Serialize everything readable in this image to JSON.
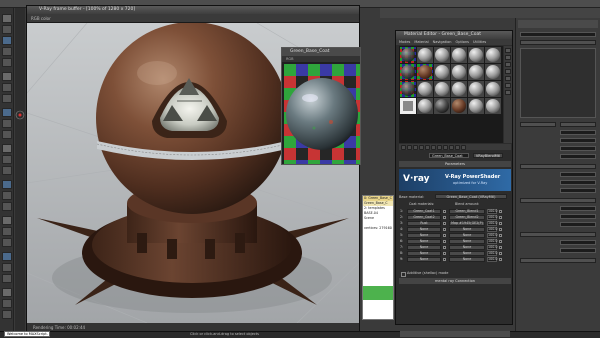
{
  "vfb": {
    "title": "V-Ray frame buffer - [100% of 1280 x 720]",
    "toolbar_channel": "RGB color",
    "status": "Rendering Time: 00:02:44"
  },
  "swatch_window": {
    "title": "Green_Base_Coat",
    "bar": "RGB"
  },
  "material_editor": {
    "title": "Material Editor - Green_Base_Coat",
    "menu": [
      "Modes",
      "Material",
      "Navigation",
      "Options",
      "Utilities"
    ],
    "material_name": "Green_Base_Coat",
    "material_type": "VRayBlendMtl",
    "params_header": "Parameters",
    "vray_logo": "V·ray",
    "vray_product": "V-Ray PowerShader",
    "vray_subtitle": "optimized for V-Ray",
    "base_material_label": "Base material:",
    "base_material_value": "Green_Base_Coat (VRayMtl)",
    "columns": [
      "Coat materials:",
      "Blend amount:"
    ],
    "rows": [
      {
        "n": "1:",
        "mat": "Green_Coat1",
        "blend": "Green_Blend1",
        "amt": "100.0"
      },
      {
        "n": "2:",
        "mat": "Green_Coat2",
        "blend": "Green_Blend2",
        "amt": "100.0"
      },
      {
        "n": "3:",
        "mat": "Rust",
        "blend": "Map #1945(GE2(P)",
        "amt": "100.0"
      },
      {
        "n": "4:",
        "mat": "None",
        "blend": "None",
        "amt": "100.0"
      },
      {
        "n": "5:",
        "mat": "None",
        "blend": "None",
        "amt": "100.0"
      },
      {
        "n": "6:",
        "mat": "None",
        "blend": "None",
        "amt": "100.0"
      },
      {
        "n": "7:",
        "mat": "None",
        "blend": "None",
        "amt": "100.0"
      },
      {
        "n": "8:",
        "mat": "None",
        "blend": "None",
        "amt": "100.0"
      },
      {
        "n": "9:",
        "mat": "None",
        "blend": "None",
        "amt": "100.0"
      }
    ],
    "additive_label": "Additive (shellac) mode",
    "rollout": "mental ray Connection"
  },
  "scene_list": [
    "0: Green_Base_C",
    "Green_Base_C",
    "2: templates",
    "BASE.04",
    "Scene",
    "",
    "vertices: 279160",
    "",
    "",
    "",
    "",
    "",
    "",
    "",
    ""
  ],
  "listener": "Welcome to MAXScript.",
  "prompt": "Click or click-and-drag to select objects",
  "colors": {
    "vray_blue": "#2f6aa6",
    "panel_bg": "#2c2c2c"
  }
}
